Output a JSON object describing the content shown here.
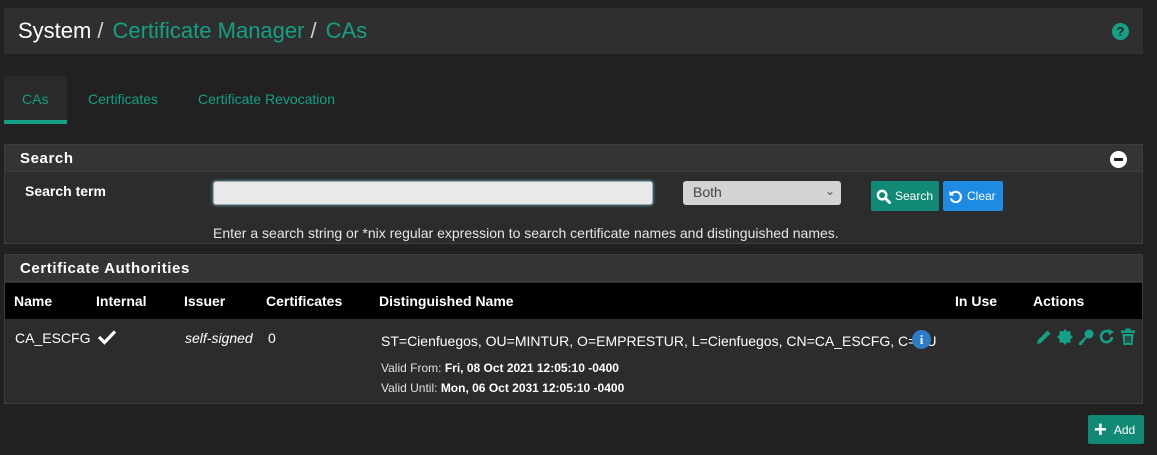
{
  "breadcrumb": {
    "root": "System",
    "sep": "/",
    "level1": "Certificate Manager",
    "level2": "CAs"
  },
  "header": {
    "help_icon": "question-circle-icon"
  },
  "tabs": [
    {
      "label": "CAs",
      "active": true
    },
    {
      "label": "Certificates",
      "active": false
    },
    {
      "label": "Certificate Revocation",
      "active": false
    }
  ],
  "search": {
    "title": "Search",
    "term_label": "Search term",
    "term_value": "",
    "scope_selected": "Both",
    "search_label": "Search",
    "clear_label": "Clear",
    "help_text": "Enter a search string or *nix regular expression to search certificate names and distinguished names."
  },
  "ca_panel": {
    "title": "Certificate Authorities",
    "columns": [
      "Name",
      "Internal",
      "Issuer",
      "Certificates",
      "Distinguished Name",
      "In Use",
      "Actions"
    ],
    "rows": [
      {
        "name": "CA_ESCFG",
        "internal": true,
        "issuer": "self-signed",
        "certificates": "0",
        "dn": "ST=Cienfuegos, OU=MINTUR, O=EMPRESTUR, L=Cienfuegos, CN=CA_ESCFG, C=CU",
        "valid_from_label": "Valid From:",
        "valid_from": "Fri, 08 Oct 2021 12:05:10 -0400",
        "valid_until_label": "Valid Until:",
        "valid_until": "Mon, 06 Oct 2031 12:05:10 -0400",
        "in_use": ""
      }
    ]
  },
  "add_label": "Add",
  "colors": {
    "accent": "#14a085",
    "button": "#108a74",
    "clear": "#1e8be3",
    "background": "#212121"
  }
}
